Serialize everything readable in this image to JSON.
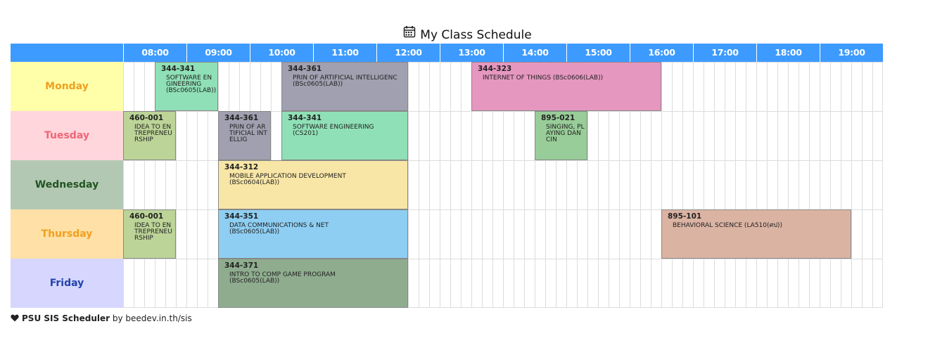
{
  "title": "My Class Schedule",
  "hours": [
    "08:00",
    "09:00",
    "10:00",
    "11:00",
    "12:00",
    "13:00",
    "14:00",
    "15:00",
    "16:00",
    "17:00",
    "18:00",
    "19:00"
  ],
  "days": [
    {
      "label": "Monday",
      "bg": "#ffffaa",
      "color": "#f0a020"
    },
    {
      "label": "Tuesday",
      "bg": "#ffd6dc",
      "color": "#ee6677"
    },
    {
      "label": "Wednesday",
      "bg": "#b3c8b3",
      "color": "#225522"
    },
    {
      "label": "Thursday",
      "bg": "#ffe0a6",
      "color": "#f0a020"
    },
    {
      "label": "Friday",
      "bg": "#d6d6ff",
      "color": "#2244aa"
    }
  ],
  "classes": [
    {
      "day": 0,
      "start": "08:00",
      "end": "09:00",
      "code": "344-341",
      "name": "SOFTWARE ENGINEERING",
      "room": "(BSc0605(LAB))",
      "color": "#8fe0b6"
    },
    {
      "day": 0,
      "start": "10:00",
      "end": "12:00",
      "code": "344-361",
      "name": "PRIN OF ARTIFICIAL INTELLIGENC",
      "room": "(BSc0605(LAB))",
      "color": "#a0a0b0"
    },
    {
      "day": 0,
      "start": "13:00",
      "end": "16:00",
      "code": "344-323",
      "name": "INTERNET OF THINGS (BSc0606(LAB))",
      "room": "",
      "color": "#e697c0"
    },
    {
      "day": 1,
      "start": "07:30",
      "end": "08:20",
      "code": "460-001",
      "name": "IDEA TO ENTREPRENEURSHIP",
      "room": "",
      "color": "#bcd498"
    },
    {
      "day": 1,
      "start": "09:00",
      "end": "09:50",
      "code": "344-361",
      "name": "PRIN OF ARTIFICIAL INTELLIG",
      "room": "",
      "color": "#a0a0b0"
    },
    {
      "day": 1,
      "start": "10:00",
      "end": "12:00",
      "code": "344-341",
      "name": "SOFTWARE ENGINEERING",
      "room": "(CS201)",
      "color": "#8fe0b6"
    },
    {
      "day": 1,
      "start": "14:00",
      "end": "14:50",
      "code": "895-021",
      "name": "SINGING, PLAYING DANCIN",
      "room": "",
      "color": "#98cc98"
    },
    {
      "day": 2,
      "start": "09:00",
      "end": "12:00",
      "code": "344-312",
      "name": "MOBILE APPLICATION DEVELOPMENT",
      "room": "(BSc0604(LAB))",
      "color": "#f8e6a6"
    },
    {
      "day": 3,
      "start": "07:30",
      "end": "08:20",
      "code": "460-001",
      "name": "IDEA TO ENTREPRENEURSHIP",
      "room": "",
      "color": "#bcd498"
    },
    {
      "day": 3,
      "start": "09:00",
      "end": "12:00",
      "code": "344-351",
      "name": "DATA COMMUNICATIONS & NET",
      "room": "(BSc0605(LAB))",
      "color": "#8ecef2"
    },
    {
      "day": 3,
      "start": "16:00",
      "end": "19:00",
      "code": "895-101",
      "name": "BEHAVIORAL SCIENCE (LA510(ศป))",
      "room": "",
      "color": "#dbb3a3"
    },
    {
      "day": 4,
      "start": "09:00",
      "end": "12:00",
      "code": "344-371",
      "name": "INTRO TO COMP GAME PROGRAM",
      "room": "(BSc0605(LAB))",
      "color": "#8fac8f"
    }
  ],
  "footer": {
    "brand": "PSU SIS Scheduler",
    "by": "by",
    "link": "beedev.in.th/sis"
  }
}
